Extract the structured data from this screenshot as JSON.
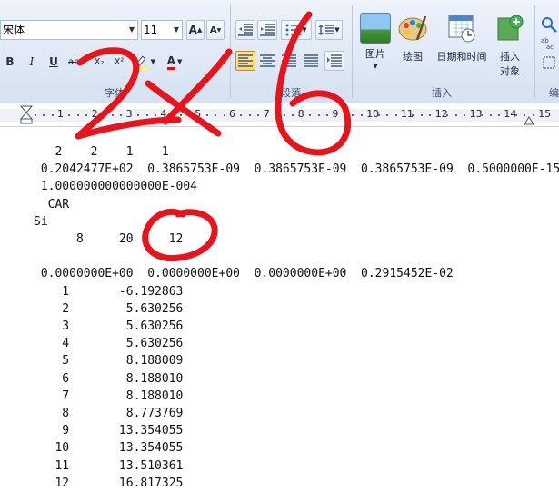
{
  "ribbon": {
    "font_name": "宋体",
    "font_size": "11",
    "groups": {
      "font": "字体",
      "paragraph": "段落",
      "insert": "插入",
      "edit_partial": "编"
    },
    "buttons": {
      "grow_font": "A",
      "shrink_font": "A",
      "bold": "B",
      "italic": "I",
      "underline": "U",
      "strike": "abc",
      "subscript": "X₂",
      "superscript": "X²",
      "font_color": "A",
      "picture": "图片",
      "drawing": "绘图",
      "datetime": "日期和时间",
      "insert_object_1": "插入",
      "insert_object_2": "对象"
    },
    "accent_color": "#ffd66b"
  },
  "ruler": {
    "numbers": [
      "1",
      "2",
      "3",
      "4",
      "5",
      "6",
      "7",
      "8",
      "9",
      "10",
      "11",
      "12",
      "13",
      "14",
      "15"
    ]
  },
  "document": {
    "lines": [
      "   2    2    1    1",
      " 0.2042477E+02  0.3865753E-09  0.3865753E-09  0.3865753E-09  0.5000000E-15",
      " 1.000000000000000E-004",
      "  CAR",
      "Si",
      "      8     20     12",
      "",
      " 0.0000000E+00  0.0000000E+00  0.0000000E+00  0.2915452E-02",
      "    1       -6.192863",
      "    2        5.630256",
      "    3        5.630256",
      "    4        5.630256",
      "    5        8.188009",
      "    6        8.188010",
      "    7        8.188010",
      "    8        8.773769",
      "    9       13.354055",
      "   10       13.354055",
      "   11       13.510361",
      "   12       16.817325"
    ]
  },
  "annotation": {
    "handwritten_text": "2×6",
    "color": "#e8141c"
  }
}
